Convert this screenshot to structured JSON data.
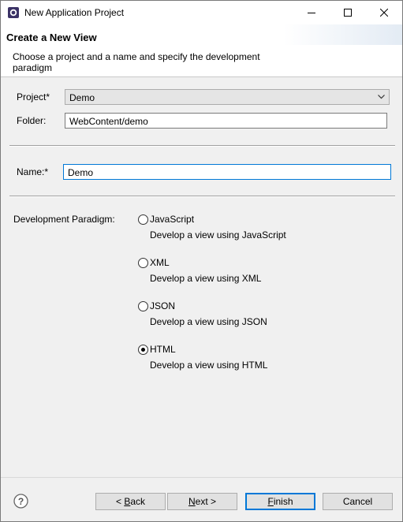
{
  "window": {
    "title": "New Application Project"
  },
  "banner": {
    "title": "Create a New View",
    "description": "Choose a project and a name and specify the development paradigm"
  },
  "form": {
    "project_label": "Project",
    "project_value": "Demo",
    "folder_label": "Folder:",
    "folder_value": "WebContent/demo",
    "name_label": "Name:",
    "name_value": "Demo",
    "required_marker": "*",
    "paradigm_label": "Development Paradigm:"
  },
  "paradigms": [
    {
      "label": "JavaScript",
      "description": "Develop a view using JavaScript",
      "selected": false
    },
    {
      "label": "XML",
      "description": "Develop a view using XML",
      "selected": false
    },
    {
      "label": "JSON",
      "description": "Develop a view using JSON",
      "selected": false
    },
    {
      "label": "HTML",
      "description": "Develop a view using HTML",
      "selected": true
    }
  ],
  "buttons": {
    "back_prefix": "< ",
    "back_mnemonic": "B",
    "back_rest": "ack",
    "next_mnemonic": "N",
    "next_rest": "ext >",
    "finish_mnemonic": "F",
    "finish_rest": "inish",
    "cancel": "Cancel"
  },
  "icons": {
    "app": "eclipse-icon",
    "minimize": "minimize-icon",
    "maximize": "maximize-icon",
    "close": "close-icon",
    "dropdown": "chevron-down-icon",
    "help": "help-icon"
  }
}
